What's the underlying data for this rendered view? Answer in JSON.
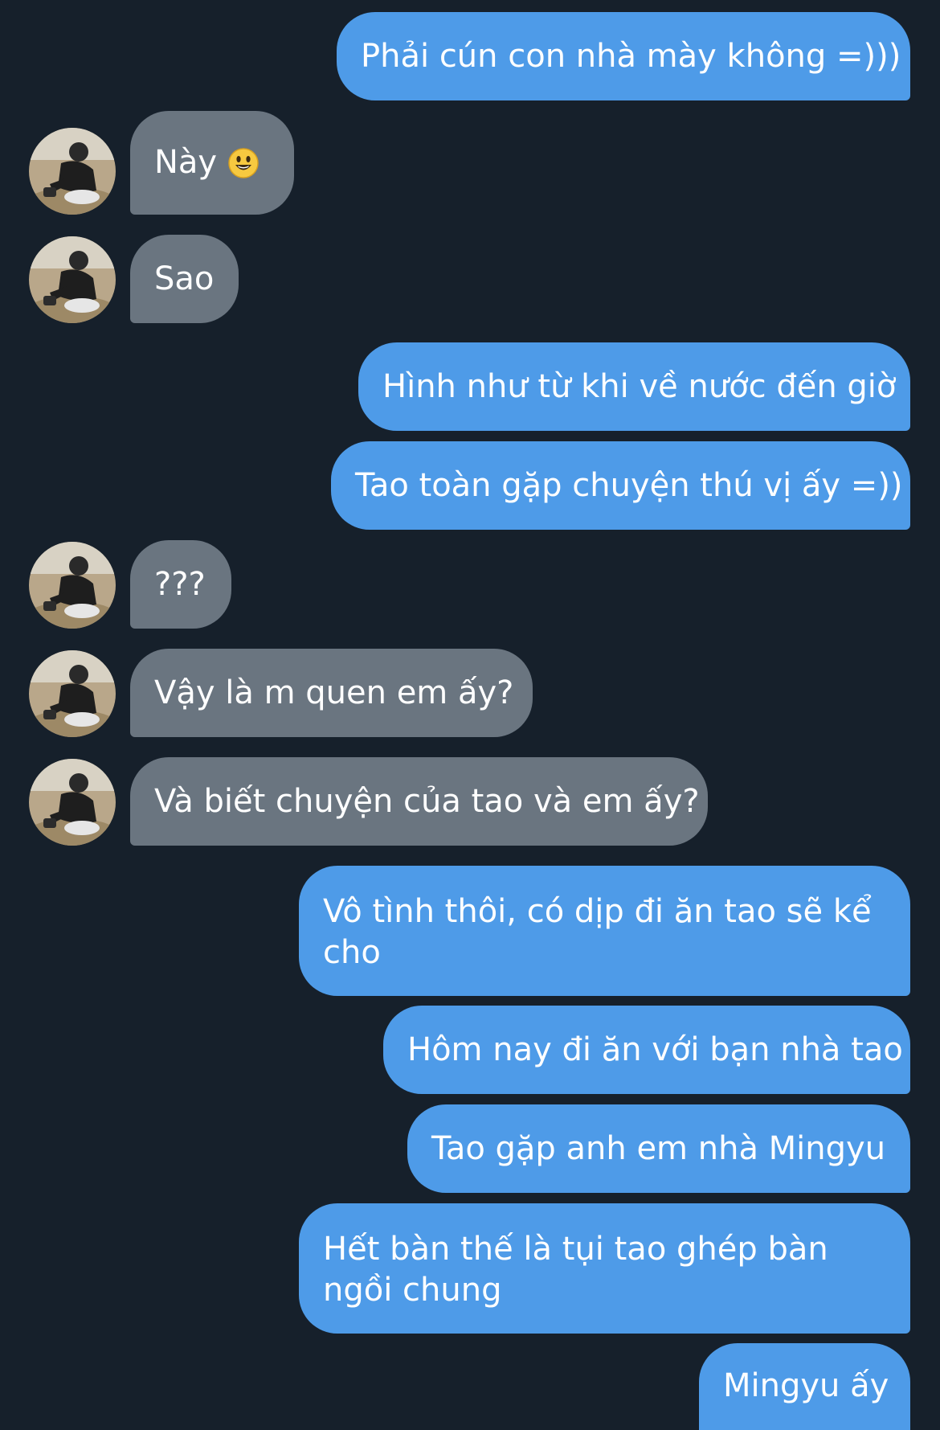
{
  "colors": {
    "background": "#16202b",
    "sent_bubble": "#4e9be8",
    "received_bubble": "#6a7580",
    "text": "#ffffff"
  },
  "avatar_icon": "user-photo-avatar",
  "messages": [
    {
      "side": "sent",
      "text": "Phải cún con nhà mày không =)))"
    },
    {
      "side": "received",
      "text": "Này",
      "emoji": "smiley-face-icon"
    },
    {
      "side": "received",
      "text": "Sao"
    },
    {
      "side": "sent",
      "text": "Hình như từ khi về nước đến giờ"
    },
    {
      "side": "sent",
      "text": "Tao toàn gặp chuyện thú vị ấy =))"
    },
    {
      "side": "received",
      "text": "???"
    },
    {
      "side": "received",
      "text": "Vậy là m quen em ấy?"
    },
    {
      "side": "received",
      "text": "Và biết chuyện của tao và em ấy?"
    },
    {
      "side": "sent",
      "text": "Vô tình thôi, có dịp đi ăn tao sẽ kể cho"
    },
    {
      "side": "sent",
      "text": "Hôm nay đi ăn với bạn nhà tao"
    },
    {
      "side": "sent",
      "text": "Tao gặp anh em nhà Mingyu"
    },
    {
      "side": "sent",
      "text": "Hết bàn thế là tụi tao ghép bàn ngồi chung"
    },
    {
      "side": "sent",
      "text": "Mingyu ấy"
    }
  ]
}
